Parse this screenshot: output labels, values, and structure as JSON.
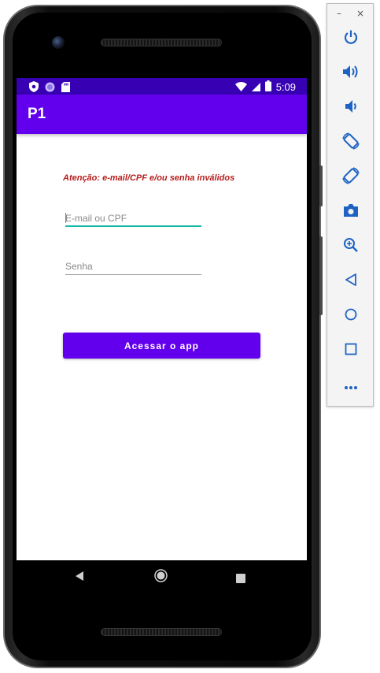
{
  "status_bar": {
    "time": "5:09"
  },
  "app_bar": {
    "title": "P1"
  },
  "login": {
    "error_message": "Atenção: e-mail/CPF e/ou senha inválidos",
    "email_placeholder": "E-mail ou CPF",
    "password_placeholder": "Senha",
    "submit_label": "Acessar o app"
  },
  "colors": {
    "status_bar": "#3700b3",
    "primary": "#6200ee",
    "error": "#b71c1c",
    "focus": "#14b8a6"
  },
  "nav_bar": {
    "icons": [
      "back-icon",
      "home-icon",
      "recents-icon"
    ]
  },
  "emulator_toolbar": {
    "window_controls": {
      "minimize": "–",
      "close": "×"
    },
    "tools": [
      "power-icon",
      "volume-up-icon",
      "volume-down-icon",
      "rotate-left-icon",
      "rotate-right-icon",
      "camera-icon",
      "zoom-icon",
      "back-icon",
      "home-icon",
      "overview-icon",
      "more-icon"
    ]
  }
}
